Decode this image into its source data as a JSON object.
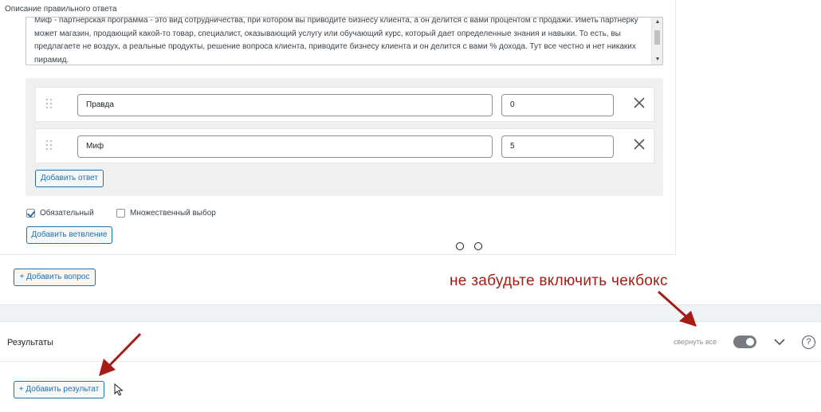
{
  "question": {
    "description_label": "Описание правильного ответа",
    "description_text": "Миф - партнерская программа - это вид сотрудничества, при котором вы приводите бизнесу клиента, а он делится с вами процентом с продажи. Иметь партнерку может магазин, продающий какой-то товар, специалист, оказывающий услугу или обучающий курс, который дает определенные знания и навыки. То есть, вы предлагаете не воздух, а реальные продукты, решение вопроса клиента, приводите бизнесу клиента и он делится с вами % дохода. Тут все честно и нет никаких пирамид.",
    "answers": [
      {
        "text": "Правда",
        "score": "0"
      },
      {
        "text": "Миф",
        "score": "5"
      }
    ],
    "add_answer_label": "Добавить ответ",
    "required_label": "Обязательный",
    "required_checked": true,
    "multiple_label": "Множественный выбор",
    "multiple_checked": false,
    "add_branch_label": "Добавить ветвление"
  },
  "add_question_label": "+ Добавить вопрос",
  "annotation": {
    "text": "не забудьте включить чекбокс",
    "color": "#a51d14"
  },
  "results": {
    "title": "Результаты",
    "collapse_all_label": "свернуть все",
    "toggle_on": true,
    "add_result_label": "+ Добавить результат"
  },
  "icons": [
    "drag-handle-icon",
    "close-icon",
    "chevron-down-icon",
    "help-icon",
    "checkmark-icon",
    "cursor-icon",
    "arrow-icon"
  ],
  "colors": {
    "accent": "#2271b1",
    "annotation": "#a51d14",
    "panel_bg": "#f0f0f1"
  }
}
